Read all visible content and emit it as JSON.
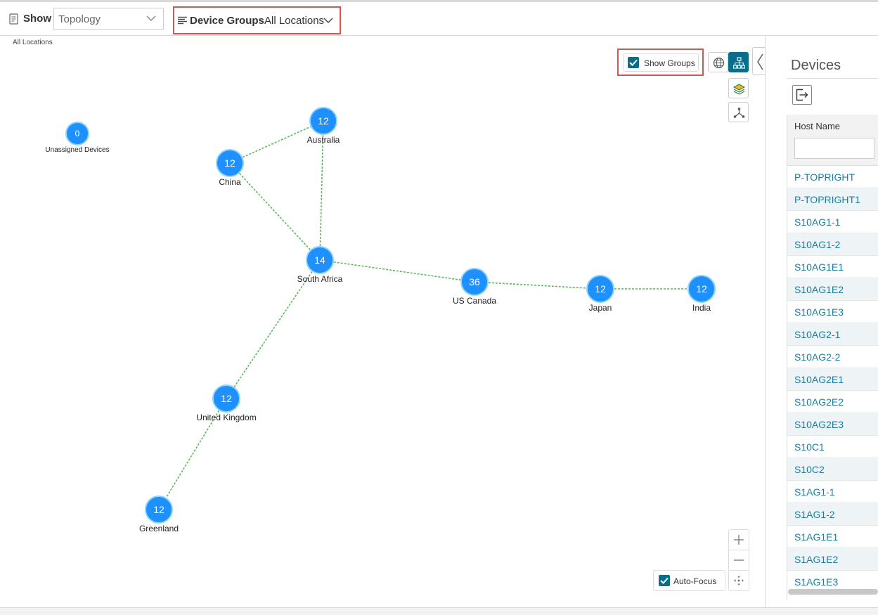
{
  "toolbar": {
    "show_label": "Show",
    "show_value": "Topology",
    "device_groups_label": "Device Groups",
    "device_groups_value": "All Locations"
  },
  "breadcrumb": "All Locations",
  "map": {
    "show_groups_label": "Show Groups",
    "show_groups_checked": true,
    "auto_focus_label": "Auto-Focus",
    "auto_focus_checked": true,
    "nodes": [
      {
        "id": "unassigned",
        "count": "0",
        "label": "Unassigned Devices"
      },
      {
        "id": "australia",
        "count": "12",
        "label": "Australia"
      },
      {
        "id": "china",
        "count": "12",
        "label": "China"
      },
      {
        "id": "south-africa",
        "count": "14",
        "label": "South Africa"
      },
      {
        "id": "us-canada",
        "count": "36",
        "label": "US Canada"
      },
      {
        "id": "japan",
        "count": "12",
        "label": "Japan"
      },
      {
        "id": "india",
        "count": "12",
        "label": "India"
      },
      {
        "id": "united-kingdom",
        "count": "12",
        "label": "United Kingdom"
      },
      {
        "id": "greenland",
        "count": "12",
        "label": "Greenland"
      }
    ],
    "links": [
      [
        "china",
        "australia"
      ],
      [
        "china",
        "south-africa"
      ],
      [
        "australia",
        "south-africa"
      ],
      [
        "south-africa",
        "us-canada"
      ],
      [
        "us-canada",
        "japan"
      ],
      [
        "japan",
        "india"
      ],
      [
        "south-africa",
        "united-kingdom"
      ],
      [
        "united-kingdom",
        "greenland"
      ]
    ],
    "link_color": "#5cb85c",
    "node_color": "#1e90ff"
  },
  "panel": {
    "title": "Devices",
    "column_header": "Host Name",
    "filter_placeholder": "",
    "hosts": [
      "P-TOPRIGHT",
      "P-TOPRIGHT1",
      "S10AG1-1",
      "S10AG1-2",
      "S10AG1E1",
      "S10AG1E2",
      "S10AG1E3",
      "S10AG2-1",
      "S10AG2-2",
      "S10AG2E1",
      "S10AG2E2",
      "S10AG2E3",
      "S10C1",
      "S10C2",
      "S1AG1-1",
      "S1AG1-2",
      "S1AG1E1",
      "S1AG1E2",
      "S1AG1E3"
    ]
  },
  "colors": {
    "accent": "#0a6e8a",
    "highlight_border": "#d9534f",
    "host_link": "#1b7fa0"
  }
}
